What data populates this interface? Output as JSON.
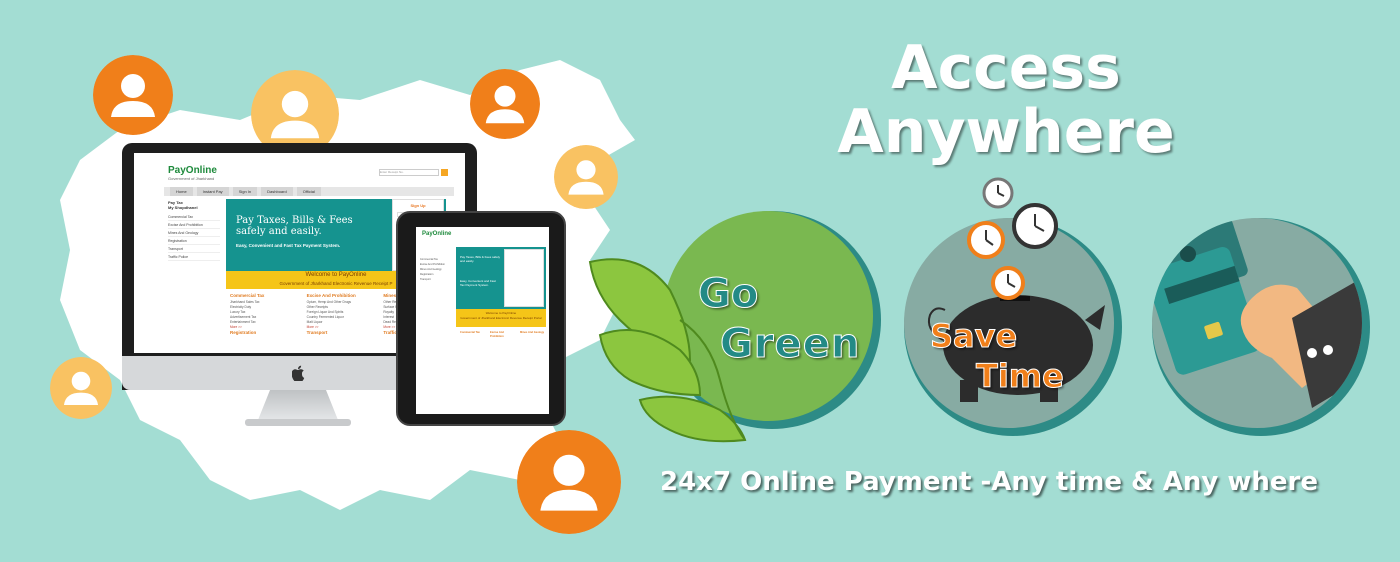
{
  "colors": {
    "background": "#a3ddd3",
    "map": "#ffffff",
    "avatar_orange": "#f07f1a",
    "avatar_yellow": "#f9c262",
    "teal": "#2d8b86",
    "green": "#7ab850",
    "grey_circle": "#87aba3",
    "site_teal": "#15938f",
    "site_yellow": "#f5c518"
  },
  "headline": {
    "line1": "Access",
    "line2": "Anywhere"
  },
  "features": {
    "go_green": {
      "word1": "Go",
      "word2": "Green",
      "icon": "leaves-icon"
    },
    "save_time": {
      "word1": "Save",
      "word2": "Time",
      "icon": "piggy-bank-clock-icon"
    },
    "card_payment": {
      "icon": "card-payment-icon"
    }
  },
  "tagline": "24x7 Online Payment -Any time & Any where",
  "desktop_site": {
    "logo": "PayOnline",
    "logo_sub": "Government of Jharkhand",
    "search_placeholder": "Enter Receipt No.",
    "nav": [
      "Home",
      "Instant Pay",
      "Sign In",
      "Dashboard",
      "Official"
    ],
    "sidebar_title_1": "Pay Tax",
    "sidebar_title_2": "My Shopdhanel",
    "sidebar": [
      "Commercial Tax",
      "Excise And Prohibition",
      "Mines And Geology",
      "Registration",
      "Transport",
      "Traffic Police"
    ],
    "banner_title": "Pay Taxes, Bills & Fees safely and easily.",
    "banner_sub": "Easy, Convenient and Fast Tax Payment System.",
    "signup_title": "Sign Up",
    "welcome_1": "Welcome to PayOnline",
    "welcome_2": "Government of Jharkhand Electronic Revenue Receipt P",
    "columns": [
      {
        "title": "Commercial Tax",
        "items": [
          "Jharkhand Sales Tax",
          "Electricity Duty",
          "Luxury Tax",
          "Advertisement Tax",
          "Entertainment Tax"
        ],
        "more": "More >>"
      },
      {
        "title": "Excise And Prohibition",
        "items": [
          "Opium, Hemp And Other Drugs",
          "Other Receipts",
          "Foreign Liquor And Spirits",
          "Country Fermented Liquor",
          "Malt Liquor"
        ],
        "more": "More >>"
      },
      {
        "title": "Mines And Geo",
        "items": [
          "Other Receipts",
          "Surface Rent",
          "Royalty",
          "Interest",
          "Dead Rent"
        ],
        "more": "More >>"
      }
    ],
    "footer_titles": [
      "Registration",
      "Transport",
      "Traffic Police"
    ]
  },
  "tablet_site": {
    "logo": "PayOnline",
    "banner_title": "Pay Taxes, Bills & Fees safely and easily.",
    "banner_sub": "Easy, Convenient and Fast Tax Payment System.",
    "welcome_1": "Welcome to PayOnline",
    "welcome_2": "Government of Jharkhand Electronic Revenue Receipt Portal",
    "col1_title": "Commercial Tax",
    "col2_title": "Excise And Prohibition",
    "col3_title": "Mines And Geology"
  }
}
